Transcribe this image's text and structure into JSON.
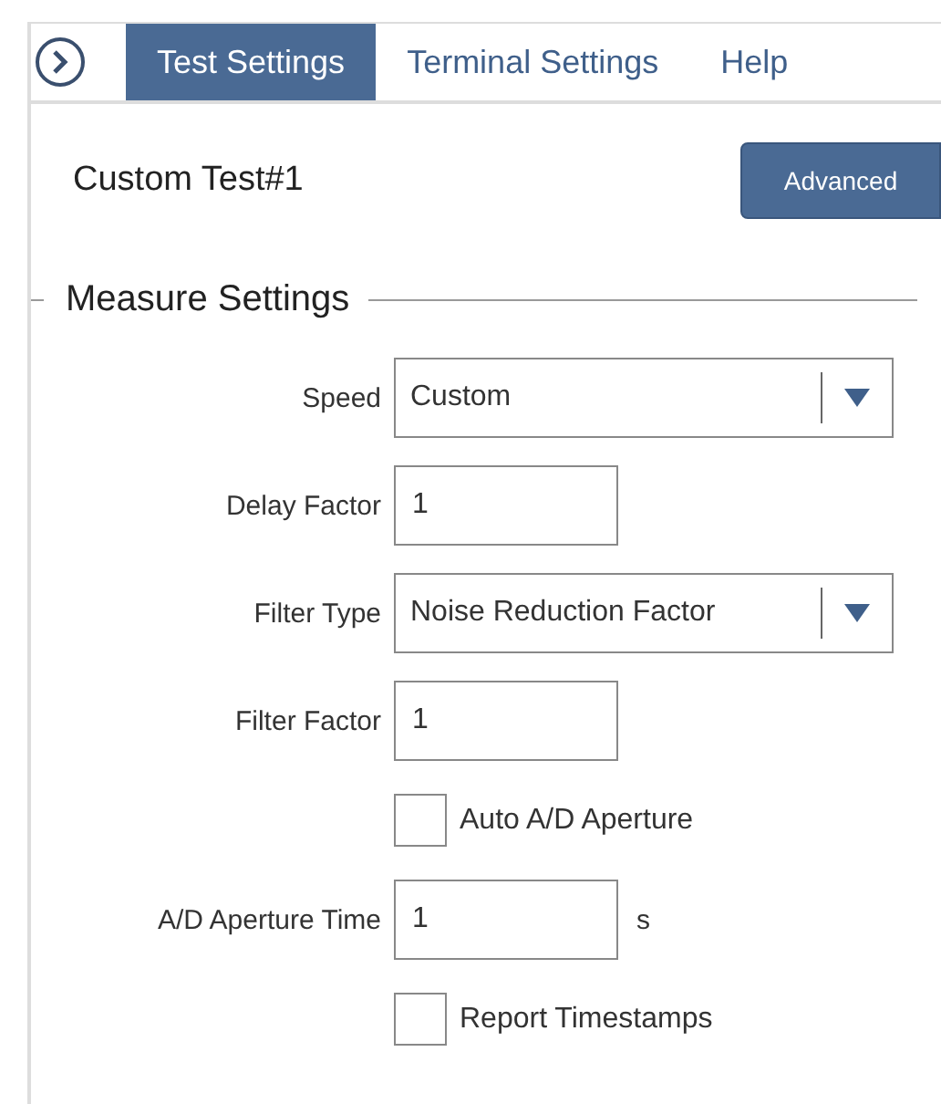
{
  "tabs": [
    {
      "label": "Test Settings",
      "selected": true
    },
    {
      "label": "Terminal Settings",
      "selected": false
    },
    {
      "label": "Help",
      "selected": false
    }
  ],
  "header": {
    "title": "Custom Test#1",
    "button": "Advanced"
  },
  "section": {
    "title": "Measure Settings",
    "rows": [
      {
        "kind": "select",
        "label": "Speed",
        "value": "Custom"
      },
      {
        "kind": "text",
        "label": "Delay Factor",
        "value": "1"
      },
      {
        "kind": "select",
        "label": "Filter Type",
        "value": "Noise Reduction Factor"
      },
      {
        "kind": "text",
        "label": "Filter Factor",
        "value": "1"
      },
      {
        "kind": "checkbox",
        "label": "Auto A/D Aperture",
        "checked": false
      },
      {
        "kind": "text",
        "label": "A/D Aperture Time",
        "value": "1",
        "unit": "s"
      },
      {
        "kind": "checkbox",
        "label": "Report Timestamps",
        "checked": false
      }
    ]
  }
}
